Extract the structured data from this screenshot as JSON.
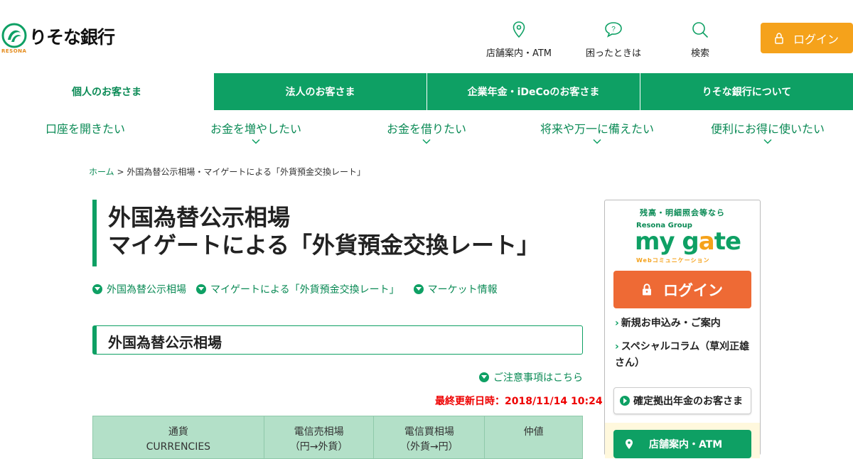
{
  "header": {
    "logo_text": "りそな銀行",
    "logo_sub": "RESONA",
    "nav": [
      {
        "label": "店舗案内・ATM",
        "icon": "map-pin-icon"
      },
      {
        "label": "困ったときは",
        "icon": "help-bubble-icon"
      },
      {
        "label": "検索",
        "icon": "search-icon"
      }
    ],
    "login_label": "ログイン"
  },
  "main_nav": {
    "tabs": [
      {
        "label": "個人のお客さま",
        "active": true
      },
      {
        "label": "法人のお客さま",
        "active": false
      },
      {
        "label": "企業年金・iDeCoのお客さま",
        "active": false
      },
      {
        "label": "りそな銀行について",
        "active": false
      }
    ]
  },
  "sub_nav": {
    "items": [
      {
        "label": "口座を開きたい",
        "has_dropdown": false
      },
      {
        "label": "お金を増やしたい",
        "has_dropdown": true
      },
      {
        "label": "お金を借りたい",
        "has_dropdown": true
      },
      {
        "label": "将来や万一に備えたい",
        "has_dropdown": true
      },
      {
        "label": "便利にお得に使いたい",
        "has_dropdown": true
      }
    ]
  },
  "breadcrumb": {
    "home": "ホーム",
    "separator": ">",
    "current": "外国為替公示相場・マイゲートによる「外貨預金交換レート」"
  },
  "page": {
    "title_line1": "外国為替公示相場",
    "title_line2": "マイゲートによる「外貨預金交換レート」",
    "anchors": [
      "外国為替公示相場",
      "マイゲートによる「外貨預金交換レート」",
      "マーケット情報"
    ],
    "section_title": "外国為替公示相場",
    "notice_link": "ご注意事項はこちら",
    "updated": "最終更新日時：2018/11/14 10:24",
    "table_headers": [
      {
        "line1": "通貨",
        "line2": "CURRENCIES"
      },
      {
        "line1": "電信売相場",
        "line2": "（円→外貨）"
      },
      {
        "line1": "電信買相場",
        "line2": "（外貨→円）"
      },
      {
        "line1": "仲値",
        "line2": ""
      }
    ]
  },
  "sidebar": {
    "caption": "残高・明細照会等なら",
    "brand_small": "Resona Group",
    "brand_main_a": "my g",
    "brand_main_b": "a",
    "brand_main_c": "te",
    "brand_sub": "Webコミュニケーション",
    "login_label": "ログイン",
    "links": [
      "新規お申込み・ご案内",
      "スペシャルコラム（草刈正雄さん）"
    ],
    "dc_button": "確定拠出年金のお客さま",
    "store_button": "店舗案内・ATM"
  },
  "colors": {
    "brand_green": "#0ea064",
    "login_orange": "#f5a21b",
    "side_login_orange": "#ee6a35",
    "alert_red": "#ee0000",
    "table_header_bg": "#b3e0c8"
  }
}
